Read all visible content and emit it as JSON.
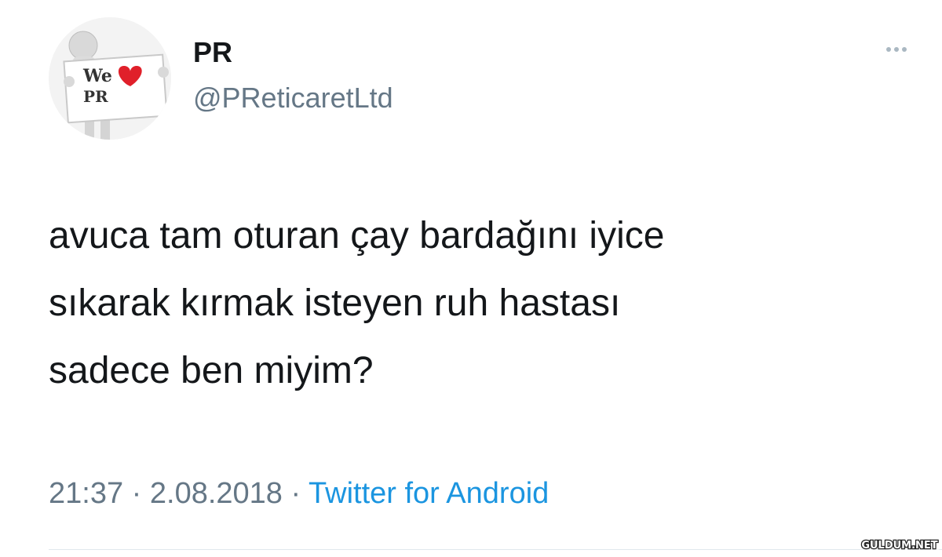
{
  "user": {
    "display_name": "PR",
    "handle": "@PReticaretLtd",
    "avatar_text": [
      "We",
      "PR"
    ]
  },
  "tweet": {
    "lines": [
      "avuca tam oturan çay bardağını iyice",
      "sıkarak kırmak isteyen ruh hastası",
      "sadece ben miyim?"
    ],
    "time": "21:37",
    "date": "2.08.2018",
    "separator": "·",
    "source": "Twitter for Android"
  },
  "icons": {
    "more": "more-horizontal-icon",
    "avatar_heart": "heart-icon"
  },
  "watermark": "GULDUM.NET",
  "colors": {
    "text": "#14171a",
    "secondary": "#657786",
    "link": "#1b95e0",
    "heart": "#e0202a"
  }
}
